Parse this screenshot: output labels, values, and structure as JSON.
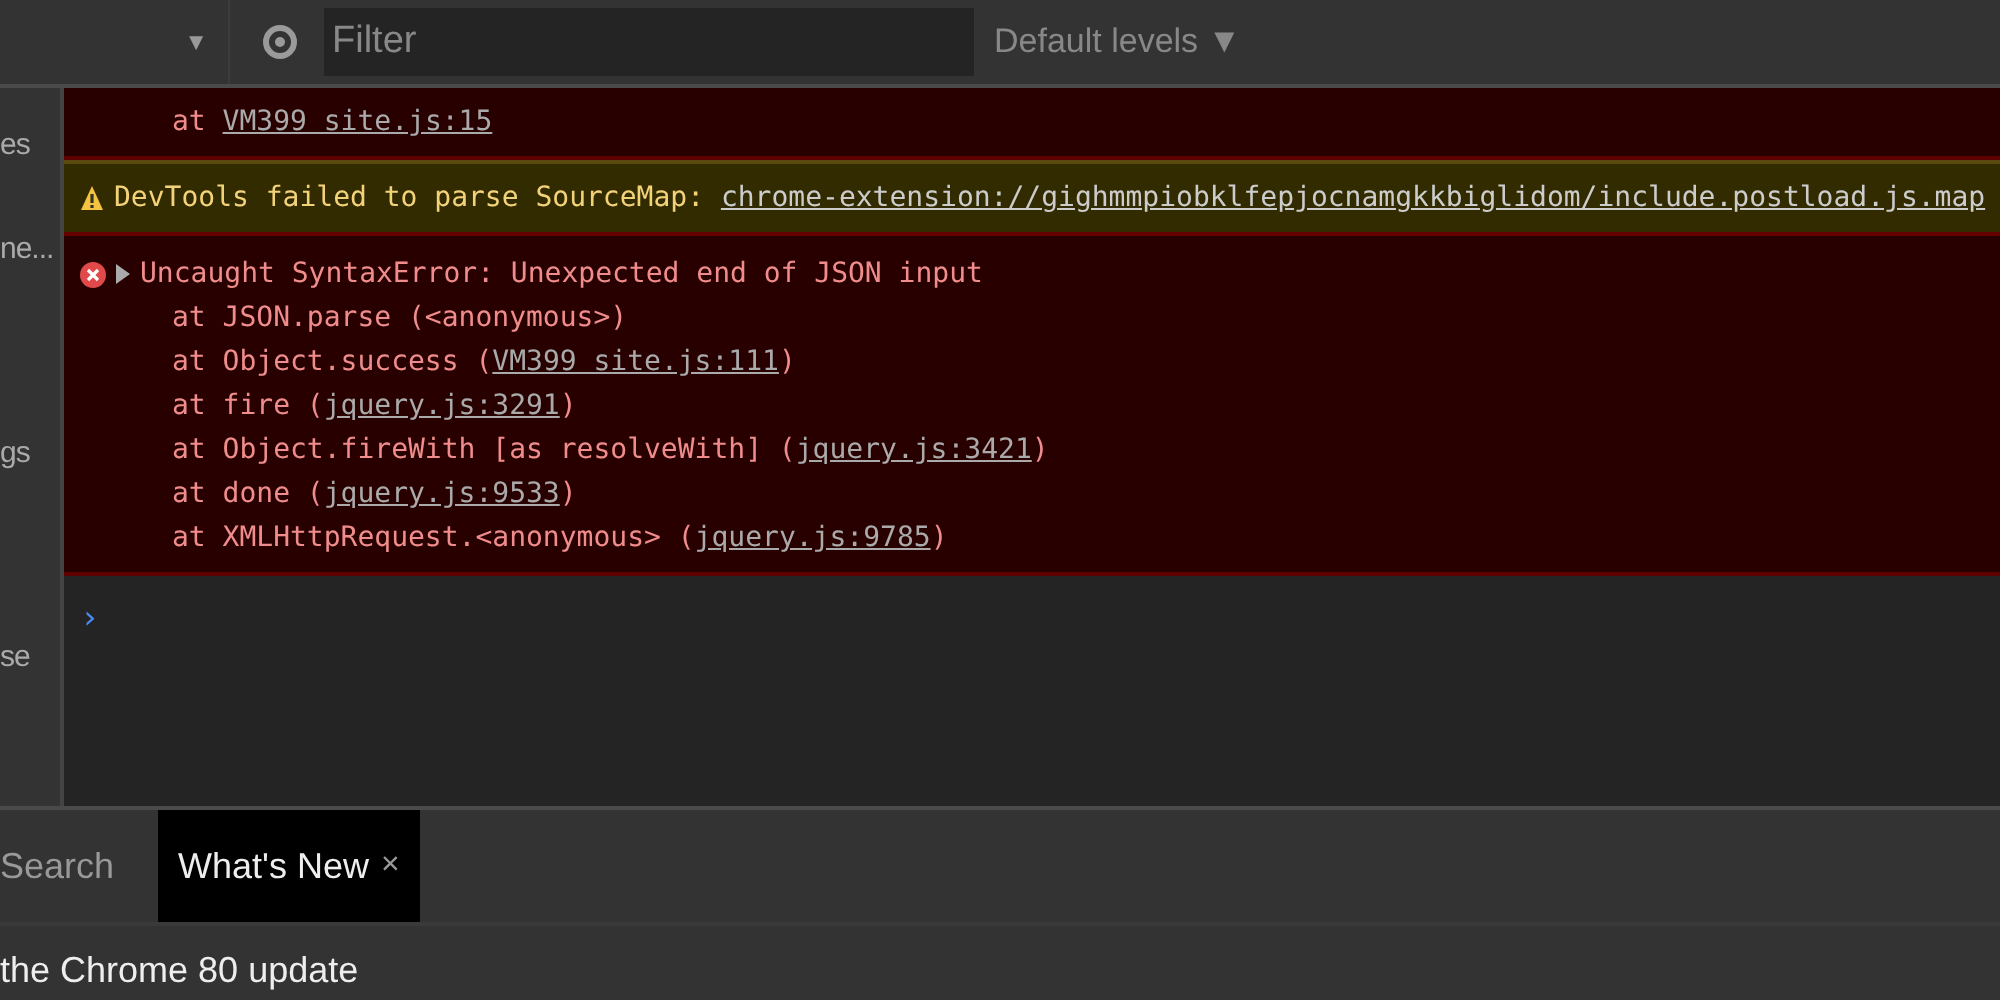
{
  "toolbar": {
    "filter": {
      "placeholder": "Filter"
    },
    "levels": "Default levels ▼",
    "caret": "▼"
  },
  "sidebar": {
    "items": [
      {
        "label": "es",
        "selected": false
      },
      {
        "label": "ne...",
        "selected": false
      },
      {
        "label": "gs",
        "selected": false
      },
      {
        "label": "se",
        "selected": false
      }
    ]
  },
  "console": {
    "messages": [
      {
        "kind": "error",
        "frames": [
          {
            "prefix": "at ",
            "link": "VM399 site.js:15"
          }
        ]
      },
      {
        "kind": "warning",
        "text": "DevTools failed to parse SourceMap: ",
        "link": "chrome-extension://gighmmpiobklfepjocnamgkkbiglidom/include.postload.js.map"
      },
      {
        "kind": "error",
        "text": "Uncaught SyntaxError: Unexpected end of JSON input",
        "frames": [
          {
            "prefix": "at JSON.parse (<anonymous>)"
          },
          {
            "prefix": "at Object.success (",
            "link": "VM399 site.js:111",
            "suffix": ")"
          },
          {
            "prefix": "at fire (",
            "link": "jquery.js:3291",
            "suffix": ")"
          },
          {
            "prefix": "at Object.fireWith [as resolveWith] (",
            "link": "jquery.js:3421",
            "suffix": ")"
          },
          {
            "prefix": "at done (",
            "link": "jquery.js:9533",
            "suffix": ")"
          },
          {
            "prefix": "at XMLHttpRequest.<anonymous> (",
            "link": "jquery.js:9785",
            "suffix": ")"
          }
        ]
      }
    ],
    "prompt": "›"
  },
  "drawer": {
    "tabs": [
      {
        "label": "Search",
        "selected": false
      },
      {
        "label": "What's New",
        "selected": true,
        "close": "×"
      }
    ],
    "content": "the Chrome 80 update"
  }
}
